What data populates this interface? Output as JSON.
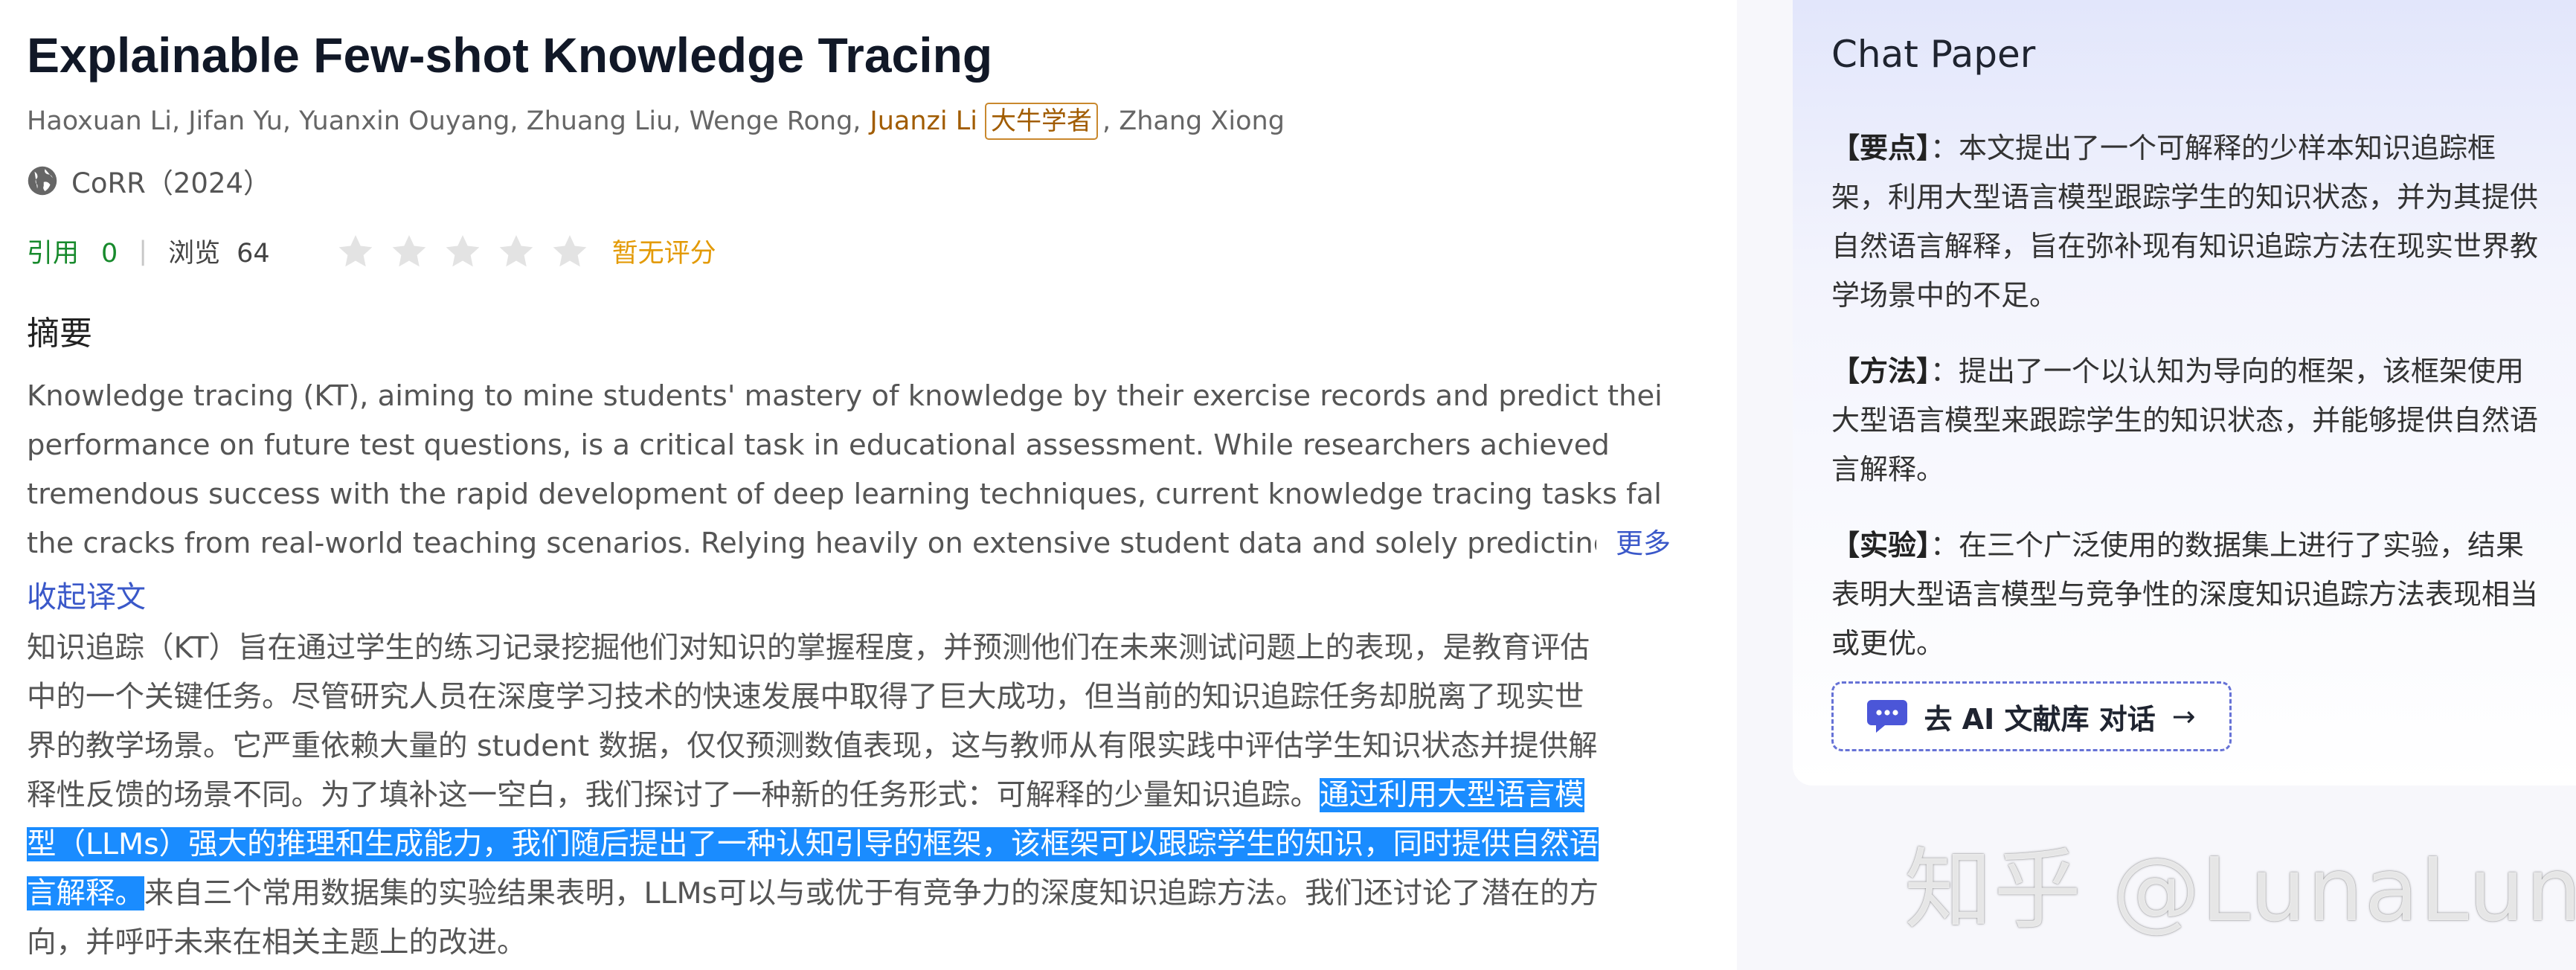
{
  "paper": {
    "title": "Explainable Few-shot Knowledge Tracing",
    "authors_before": "Haoxuan Li, Jifan Yu, Yuanxin Ouyang, Zhuang Liu, Wenge Rong,",
    "highlight_author": "Juanzi Li",
    "badge": "大牛学者",
    "authors_after": ", Zhang Xiong",
    "venue": "CoRR（2024）",
    "venue_icon": "globe-icon"
  },
  "stats": {
    "cite_label": "引用",
    "cite_count": "0",
    "separator": "|",
    "views_label": "浏览",
    "views_count": "64",
    "rating_stars": 5,
    "rating_value": 0,
    "rating_text": "暂无评分"
  },
  "abstract": {
    "heading": "摘要",
    "en_lines": [
      "Knowledge tracing (KT), aiming to mine students' mastery of knowledge by their exercise records and predict their",
      "performance on future test questions, is a critical task in educational assessment. While researchers achieved",
      "tremendous success with the rapid development of deep learning techniques, current knowledge tracing tasks fall into",
      "the cracks from real-world teaching scenarios. Relying heavily on extensive student data and solely predicting num"
    ],
    "more_label": "更多",
    "collapse_label": "收起译文",
    "zh_lines": [
      "知识追踪（KT）旨在通过学生的练习记录挖掘他们对知识的掌握程度，并预测他们在未来测试问题上的表现，是教育评估",
      "中的一个关键任务。尽管研究人员在深度学习技术的快速发展中取得了巨大成功，但当前的知识追踪任务却脱离了现实世",
      "界的教学场景。它严重依赖大量的 student 数据，仅仅预测数值表现，这与教师从有限实践中评估学生知识状态并提供解"
    ],
    "zh_line4_plain": "释性反馈的场景不同。为了填补这一空白，我们探讨了一种新的任务形式：可解释的少量知识追踪。",
    "zh_line4_selected": "通过利用大型语言模",
    "zh_line5_selected": "型（LLMs）强大的推理和生成能力，我们随后提出了一种认知引导的框架，该框架可以跟踪学生的知识，同时提供自然语",
    "zh_line6_selected": "言解释。",
    "zh_line6_plain": "来自三个常用数据集的实验结果表明，LLMs可以与或优于有竞争力的深度知识追踪方法。我们还讨论了潜在的方",
    "zh_line7": "向，并呼吁未来在相关主题上的改进。"
  },
  "chat": {
    "title": "Chat Paper",
    "sections": [
      {
        "tag": "【要点】",
        "lines": [
          "：本文提出了一个可解释的少样本知识追踪框",
          "架，利用大型语言模型跟踪学生的知识状态，并为其提供",
          "自然语言解释，旨在弥补现有知识追踪方法在现实世界教",
          "学场景中的不足。"
        ]
      },
      {
        "tag": "【方法】",
        "lines": [
          "：提出了一个以认知为导向的框架，该框架使用",
          "大型语言模型来跟踪学生的知识状态，并能够提供自然语",
          "言解释。"
        ]
      },
      {
        "tag": "【实验】",
        "lines": [
          "：在三个广泛使用的数据集上进行了实验，结果",
          "表明大型语言模型与竞争性的深度知识追踪方法表现相当",
          "或更优。"
        ]
      }
    ],
    "button_label": "去 AI 文献库 对话",
    "button_icon": "chat-bubble-icon",
    "button_arrow": "→"
  },
  "watermark": "知乎 @LunaLuna",
  "colors": {
    "accent_blue": "#3a58c9",
    "selection": "#1a8cff",
    "cite_green": "#178a2c",
    "rating_orange": "#e39a05",
    "author_highlight": "#a15c00"
  }
}
